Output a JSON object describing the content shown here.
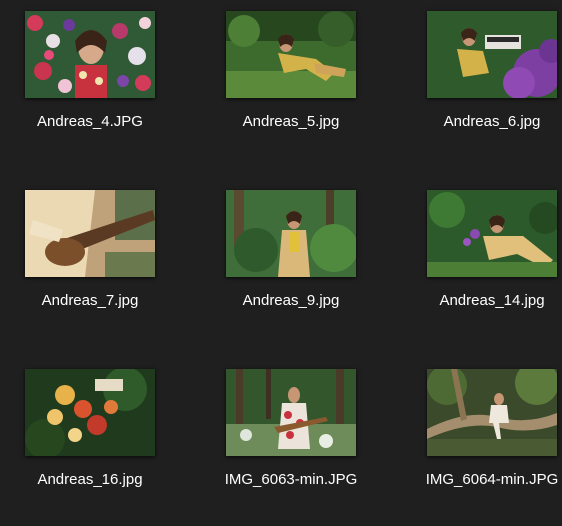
{
  "files": [
    {
      "name": "Andreas_4.JPG",
      "icon": "image-thumbnail-icon"
    },
    {
      "name": "Andreas_5.jpg",
      "icon": "image-thumbnail-icon"
    },
    {
      "name": "Andreas_6.jpg",
      "icon": "image-thumbnail-icon"
    },
    {
      "name": "Andreas_7.jpg",
      "icon": "image-thumbnail-icon"
    },
    {
      "name": "Andreas_9.jpg",
      "icon": "image-thumbnail-icon"
    },
    {
      "name": "Andreas_14.jpg",
      "icon": "image-thumbnail-icon"
    },
    {
      "name": "Andreas_16.jpg",
      "icon": "image-thumbnail-icon"
    },
    {
      "name": "IMG_6063-min.JPG",
      "icon": "image-thumbnail-icon"
    },
    {
      "name": "IMG_6064-min.JPG",
      "icon": "image-thumbnail-icon"
    }
  ],
  "colors": {
    "background": "#1f1f1f",
    "caption_text": "#ffffff"
  }
}
